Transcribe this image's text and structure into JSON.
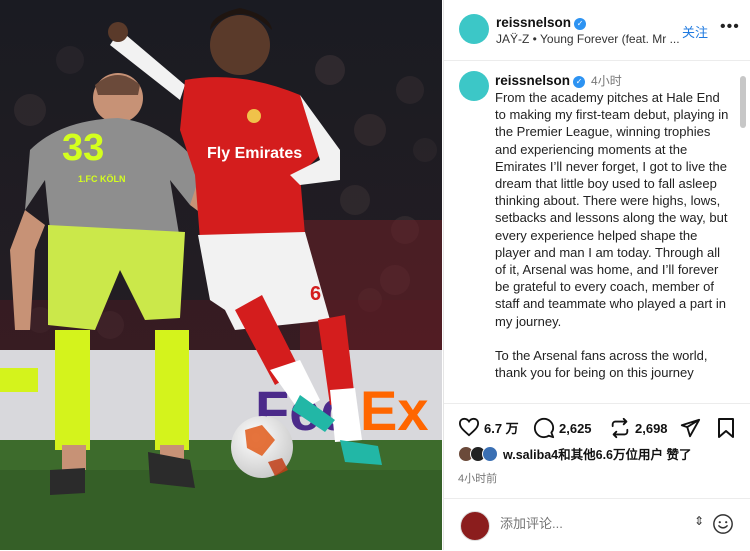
{
  "post": {
    "author": "reissnelson",
    "music": "JAŸ-Z • Young Forever (feat. Mr ...",
    "follow_label": "关注",
    "more_label": "•••"
  },
  "photo": {
    "jersey_number_left": "33",
    "jersey_crest_left": "1.FC KÖLN",
    "sponsor_right": "Fly Emirates",
    "right_player_number": "6",
    "board_text": "FedEx"
  },
  "caption": {
    "author": "reissnelson",
    "time": "4小时",
    "text": "From the academy pitches at Hale End to making my first-team debut, playing in the Premier League, winning trophies and experiencing moments at the Emirates I’ll never forget, I got to live the dream that little boy used to fall asleep thinking about. There were highs, lows, setbacks and lessons along the way, but every experience helped shape the player and man I am today. Through all of it, Arsenal was home, and I’ll forever be grateful to every coach, member of staff and teammate who played a part in my journey.\n\nTo the Arsenal fans across the world, thank you for being on this journey"
  },
  "actions": {
    "likes": "6.7 万",
    "comments": "2,625",
    "reposts": "2,698"
  },
  "liked_by": "w.saliba4和其他6.6万位用户 赞了",
  "post_time": "4小时前",
  "comment": {
    "placeholder": "添加评论...",
    "updown": "⇕"
  },
  "colors": {
    "avatar": "#3cc7c7",
    "follow": "#1f7ae0",
    "verified": "#2d93f2",
    "arsenal_red": "#d41d1d"
  }
}
